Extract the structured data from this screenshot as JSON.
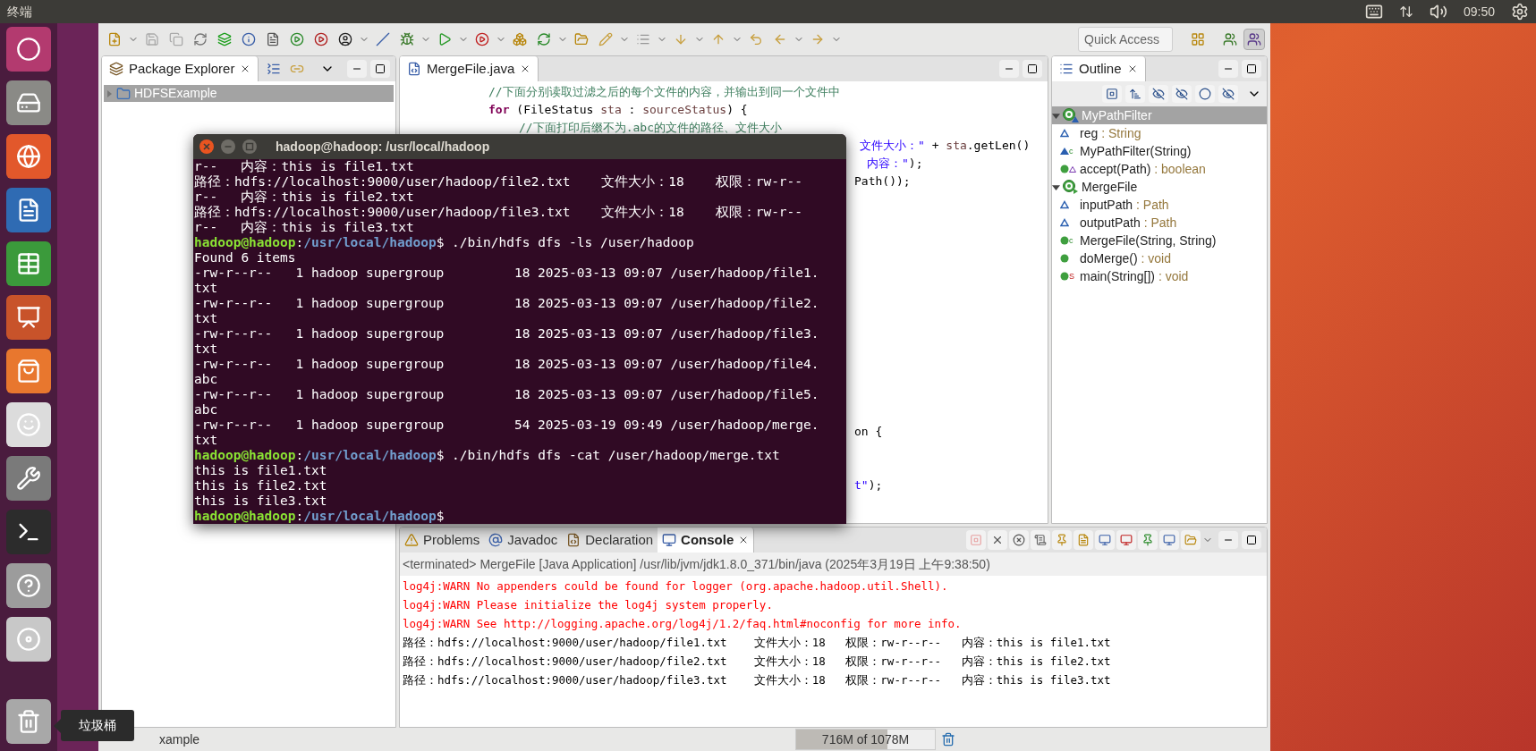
{
  "top_bar": {
    "title": "终端",
    "clock": "09:50"
  },
  "launcher_tooltip": "垃圾桶",
  "eclipse": {
    "toolbar": {
      "quick_access": {
        "placeholder": "Quick Access"
      }
    },
    "package_explorer": {
      "tab": "Package Explorer",
      "items": [
        {
          "label": "HDFSExample",
          "selected": true,
          "expanded": false
        }
      ]
    },
    "editor": {
      "tab": "MergeFile.java",
      "lines": [
        {
          "segments": [
            {
              "kind": "comment",
              "text": "//下面分别读取过滤之后的每个文件的内容，并输出到同一个文件中"
            }
          ]
        },
        {
          "segments": [
            {
              "kind": "keyword",
              "text": "for"
            },
            {
              "kind": "plain",
              "text": " (FileStatus "
            },
            {
              "kind": "variable",
              "text": "sta"
            },
            {
              "kind": "plain",
              "text": " : "
            },
            {
              "kind": "variable",
              "text": "sourceStatus"
            },
            {
              "kind": "plain",
              "text": ") {"
            }
          ]
        },
        {
          "segments": [
            {
              "kind": "comment",
              "text": "//下面打印后缀不为.abc的文件的路径、文件大小"
            }
          ]
        },
        {
          "segments": [
            {
              "kind": "string",
              "text": "文件大小：\""
            },
            {
              "kind": "plain",
              "text": " + "
            },
            {
              "kind": "variable",
              "text": "sta"
            },
            {
              "kind": "plain",
              "text": ".getLen()"
            }
          ]
        },
        {
          "segments": [
            {
              "kind": "string",
              "text": "内容：\""
            },
            {
              "kind": "plain",
              "text": ");"
            }
          ]
        },
        {
          "segments": [
            {
              "kind": "plain",
              "text": "Path());"
            }
          ]
        },
        {
          "segments": [
            {
              "kind": "plain",
              "text": "on {"
            }
          ]
        },
        {
          "segments": [
            {
              "kind": "string",
              "text": "t\""
            },
            {
              "kind": "plain",
              "text": ");"
            }
          ]
        }
      ]
    },
    "outline": {
      "tab": "Outline",
      "items": [
        {
          "name": "MyPathFilter",
          "public": false,
          "selected": true,
          "expanded": true,
          "children": [
            {
              "name": "reg",
              "type": ": String",
              "kind": "field",
              "public": false
            },
            {
              "name": "MyPathFilter(String)",
              "kind": "method",
              "public": false,
              "badge": "c"
            },
            {
              "name": "accept(Path)",
              "type": ": boolean",
              "kind": "method",
              "public": true,
              "override": true
            }
          ]
        },
        {
          "name": "MergeFile",
          "public": true,
          "selected": false,
          "expanded": true,
          "children": [
            {
              "name": "inputPath",
              "type": ": Path",
              "kind": "field",
              "public": false
            },
            {
              "name": "outputPath",
              "type": ": Path",
              "kind": "field",
              "public": false
            },
            {
              "name": "MergeFile(String, String)",
              "kind": "method",
              "public": true,
              "badge": "c"
            },
            {
              "name": "doMerge()",
              "type": ": void",
              "kind": "method",
              "public": true
            },
            {
              "name": "main(String[])",
              "type": ": void",
              "kind": "method",
              "public": true,
              "badge": "S"
            }
          ]
        }
      ]
    },
    "console": {
      "tabs": [
        {
          "label": "Problems",
          "kind": "problems",
          "selected": false
        },
        {
          "label": "Javadoc",
          "kind": "javadoc",
          "selected": false
        },
        {
          "label": "Declaration",
          "kind": "declaration",
          "selected": false
        },
        {
          "label": "Console",
          "kind": "console",
          "selected": true
        }
      ],
      "header": "<terminated> MergeFile [Java Application] /usr/lib/jvm/jdk1.8.0_371/bin/java (2025年3月19日 上午9:38:50)",
      "lines": [
        {
          "kind": "error",
          "text": "log4j:WARN No appenders could be found for logger (org.apache.hadoop.util.Shell)."
        },
        {
          "kind": "error",
          "text": "log4j:WARN Please initialize the log4j system properly."
        },
        {
          "kind": "error",
          "text": "log4j:WARN See http://logging.apache.org/log4j/1.2/faq.html#noconfig for more info."
        },
        {
          "kind": "output",
          "text": "路径：hdfs://localhost:9000/user/hadoop/file1.txt    文件大小：18   权限：rw-r--r--   内容：this is file1.txt"
        },
        {
          "kind": "output",
          "text": "路径：hdfs://localhost:9000/user/hadoop/file2.txt    文件大小：18   权限：rw-r--r--   内容：this is file2.txt"
        },
        {
          "kind": "output",
          "text": "路径：hdfs://localhost:9000/user/hadoop/file3.txt    文件大小：18   权限：rw-r--r--   内容：this is file3.txt"
        }
      ]
    },
    "status_bar": {
      "text": "xample",
      "memory": {
        "text": "716M of 1078M",
        "level": 0.66
      }
    }
  },
  "terminal": {
    "title": "hadoop@hadoop: /usr/local/hadoop",
    "lines": [
      {
        "kind": "output",
        "text": "r--   内容：this is file1.txt"
      },
      {
        "kind": "output",
        "text": "路径：hdfs://localhost:9000/user/hadoop/file2.txt    文件大小：18    权限：rw-r--"
      },
      {
        "kind": "output",
        "text": "r--   内容：this is file2.txt"
      },
      {
        "kind": "output",
        "text": "路径：hdfs://localhost:9000/user/hadoop/file3.txt    文件大小：18    权限：rw-r--"
      },
      {
        "kind": "output",
        "text": "r--   内容：this is file3.txt"
      },
      {
        "kind": "prompt",
        "user": "hadoop@hadoop",
        "separator": ":",
        "path": "/usr/local/hadoop",
        "symbol": "$",
        "command": "./bin/hdfs dfs -ls /user/hadoop"
      },
      {
        "kind": "output",
        "text": "Found 6 items"
      },
      {
        "kind": "output",
        "text": "-rw-r--r--   1 hadoop supergroup         18 2025-03-13 09:07 /user/hadoop/file1."
      },
      {
        "kind": "output",
        "text": "txt"
      },
      {
        "kind": "output",
        "text": "-rw-r--r--   1 hadoop supergroup         18 2025-03-13 09:07 /user/hadoop/file2."
      },
      {
        "kind": "output",
        "text": "txt"
      },
      {
        "kind": "output",
        "text": "-rw-r--r--   1 hadoop supergroup         18 2025-03-13 09:07 /user/hadoop/file3."
      },
      {
        "kind": "output",
        "text": "txt"
      },
      {
        "kind": "output",
        "text": "-rw-r--r--   1 hadoop supergroup         18 2025-03-13 09:07 /user/hadoop/file4."
      },
      {
        "kind": "output",
        "text": "abc"
      },
      {
        "kind": "output",
        "text": "-rw-r--r--   1 hadoop supergroup         18 2025-03-13 09:07 /user/hadoop/file5."
      },
      {
        "kind": "output",
        "text": "abc"
      },
      {
        "kind": "output",
        "text": "-rw-r--r--   1 hadoop supergroup         54 2025-03-19 09:49 /user/hadoop/merge."
      },
      {
        "kind": "output",
        "text": "txt"
      },
      {
        "kind": "prompt",
        "user": "hadoop@hadoop",
        "separator": ":",
        "path": "/usr/local/hadoop",
        "symbol": "$",
        "command": "./bin/hdfs dfs -cat /user/hadoop/merge.txt"
      },
      {
        "kind": "output",
        "text": "this is file1.txt"
      },
      {
        "kind": "output",
        "text": "this is file2.txt"
      },
      {
        "kind": "output",
        "text": "this is file3.txt"
      },
      {
        "kind": "prompt",
        "user": "hadoop@hadoop",
        "separator": ":",
        "path": "/usr/local/hadoop",
        "symbol": "$"
      }
    ]
  }
}
